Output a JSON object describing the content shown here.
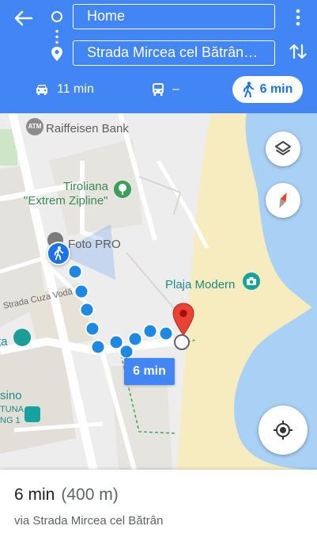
{
  "header": {
    "origin_value": "Home",
    "destination_value": "Strada Mircea cel Bătrân…",
    "modes": {
      "drive": {
        "time": "11 min",
        "icon": "car-icon"
      },
      "transit": {
        "time": "–",
        "icon": "bus-icon"
      },
      "walk": {
        "time": "6 min",
        "icon": "walk-icon",
        "selected": true
      }
    }
  },
  "map": {
    "labels": {
      "bank": "Raiffeisen Bank",
      "atm": "ATM",
      "zipline_line1": "Tiroliana",
      "zipline_line2": "\"Extrem Zipline\"",
      "foto": "Foto PRO",
      "beach": "Plaja Modern",
      "street": "Strada Cuza Vodă",
      "left_cut": "ța",
      "casino": "sino",
      "casino2": "TUNA",
      "casino3": "NG 1"
    },
    "route_duration_chip": "6 min",
    "colors": {
      "route": "#1e88e5",
      "water": "#a9d0f5",
      "sand": "#f6ecbf",
      "pin": "#ea4335"
    }
  },
  "summary": {
    "time": "6 min",
    "distance": "(400 m)",
    "via": "via Strada Mircea cel Bătrân"
  }
}
